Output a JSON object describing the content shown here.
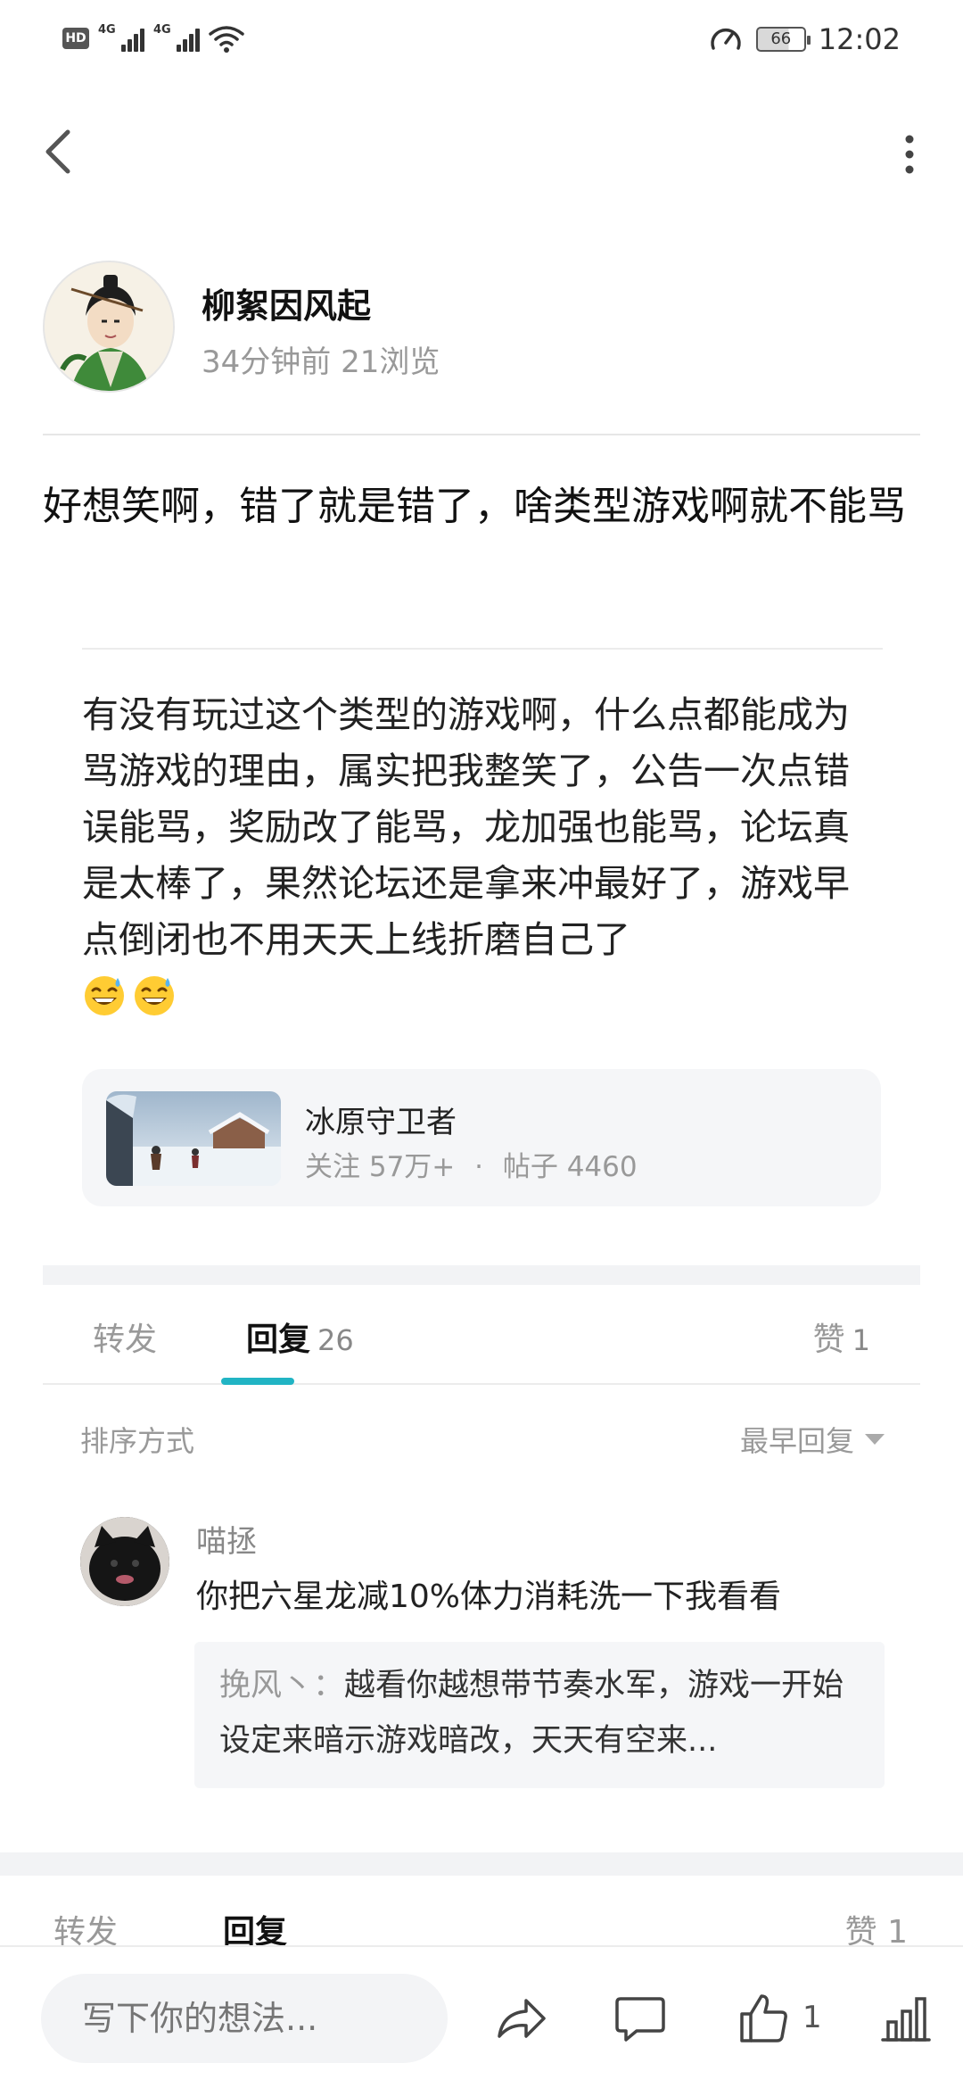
{
  "status_bar": {
    "hd_label": "HD",
    "sim1_label": "4G",
    "sim2_label": "4G",
    "battery_level": "66",
    "time": "12:02"
  },
  "author": {
    "name": "柳絮因风起",
    "time_ago": "34分钟前",
    "views": "21浏览"
  },
  "post": {
    "title": "好想笑啊，错了就是错了，啥类型游戏啊就不能骂",
    "body": "有没有玩过这个类型的游戏啊，什么点都能成为骂游戏的理由，属实把我整笑了，公告一次点错误能骂，奖励改了能骂，龙加强也能骂，论坛真是太棒了，果然论坛还是拿来冲最好了，游戏早点倒闭也不用天天上线折磨自己了",
    "emojis": [
      "grin-sweat-emoji",
      "grin-sweat-emoji"
    ]
  },
  "game_card": {
    "name": "冰原守卫者",
    "followers": "关注 57万+",
    "dot": "·",
    "posts": "帖子 4460"
  },
  "tabs": {
    "forward": "转发",
    "reply": "回复",
    "reply_count": "26",
    "like": "赞",
    "like_count": "1"
  },
  "sort": {
    "label": "排序方式",
    "selected": "最早回复"
  },
  "comments": [
    {
      "name": "喵拯",
      "text": "你把六星龙减10%体力消耗洗一下我看看",
      "reply_name": "挽风丶：",
      "reply_text": "越看你越想带节奏水军，游戏一开始设定来暗示游戏暗改，天天有空来..."
    }
  ],
  "sticky_tabs": {
    "forward": "转发",
    "reply": "回复",
    "like": "赞 1"
  },
  "bottom_bar": {
    "input_placeholder": "写下你的想法...",
    "like_count": "1"
  },
  "colors": {
    "accent": "#21b4c4",
    "muted_text": "#999999",
    "card_bg": "#f5f6f8"
  }
}
